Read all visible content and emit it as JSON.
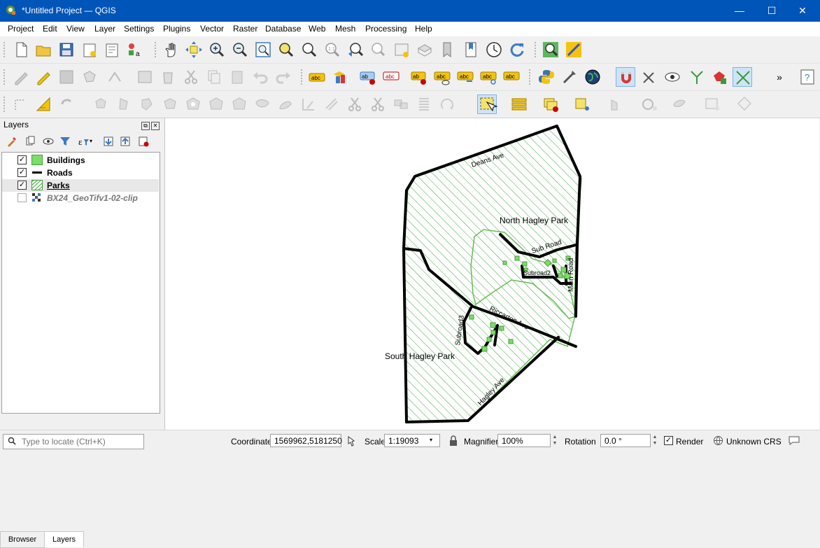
{
  "window": {
    "title": "*Untitled Project — QGIS",
    "controls": [
      "—",
      "☐",
      "✕"
    ]
  },
  "menu": [
    "Project",
    "Edit",
    "View",
    "Layer",
    "Settings",
    "Plugins",
    "Vector",
    "Raster",
    "Database",
    "Web",
    "Mesh",
    "Processing",
    "Help"
  ],
  "layers_panel": {
    "title": "Layers",
    "layers": [
      {
        "name": "Buildings",
        "checked": true,
        "checkmark": "✓",
        "symbol": "polygon-fill"
      },
      {
        "name": "Roads",
        "checked": true,
        "checkmark": "✓",
        "symbol": "line"
      },
      {
        "name": "Parks",
        "checked": true,
        "checkmark": "✓",
        "symbol": "hatch-fill"
      },
      {
        "name": "BX24_GeoTifv1-02-clip",
        "checked": false,
        "checkmark": "",
        "symbol": "raster"
      }
    ],
    "tabs": [
      "Browser",
      "Layers"
    ],
    "active_tab": "Layers"
  },
  "map": {
    "labels": {
      "deans": "Deans Ave",
      "north_park": "North Hagley Park",
      "sub_road": "Sub Road",
      "subroad2": "Subroad2",
      "main_road": "Main Road",
      "riccarton": "Riccarton Ave",
      "subroad3": "Subroad3",
      "south_park": "South Hagley Park",
      "hagley": "Hagley Ave"
    },
    "colors": {
      "park_fill": "#3aa33a",
      "park_edge": "#66bb55",
      "road": "#000000",
      "building": "#7ddc6a",
      "building_edge": "#4a9c3a"
    }
  },
  "status": {
    "locate_placeholder": "Type to locate (Ctrl+K)",
    "coordinate_label": "Coordinate",
    "coordinate_value": "1569962,5181250",
    "scale_label": "Scale",
    "scale_value": "1:19093",
    "magnifier_label": "Magnifier",
    "magnifier_value": "100%",
    "rotation_label": "Rotation",
    "rotation_value": "0.0 °",
    "render_label": "Render",
    "render_checked": true,
    "render_checkmark": "✓",
    "crs_label": "Unknown CRS"
  }
}
